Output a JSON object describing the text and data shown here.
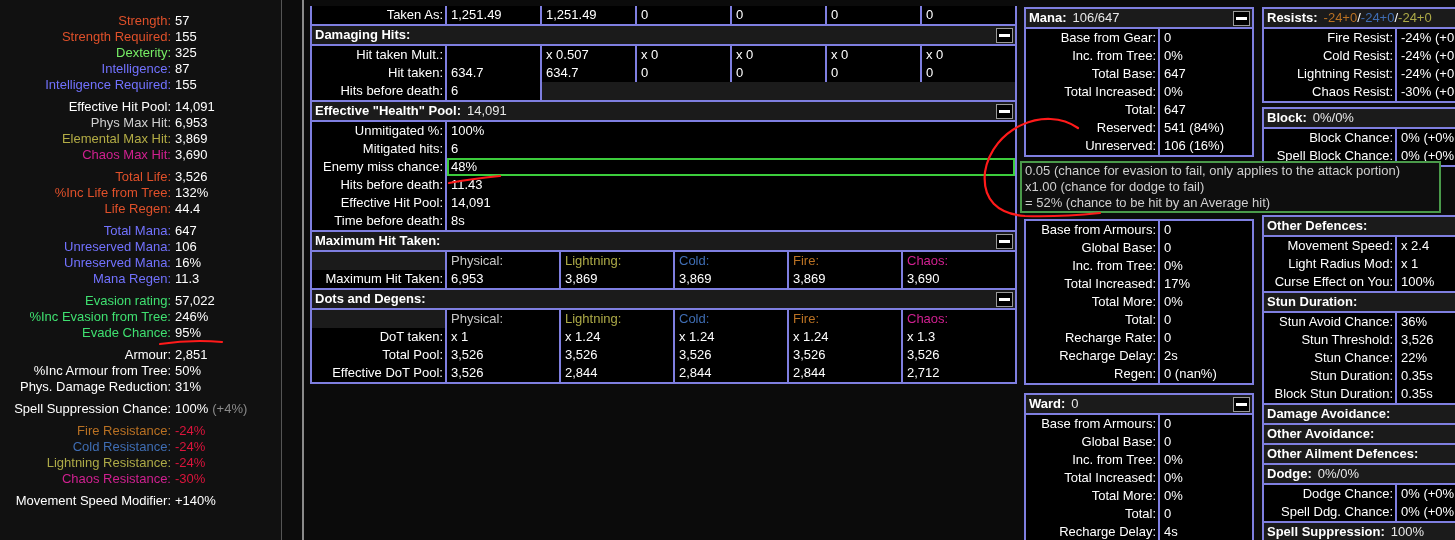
{
  "sidebar": {
    "groups": [
      {
        "rows": [
          {
            "label": "Strength:",
            "value": "57",
            "color": "#e0502a",
            "negative": false
          },
          {
            "label": "Strength Required:",
            "value": "155",
            "color": "#e0502a",
            "negative": false
          },
          {
            "label": "Dexterity:",
            "value": "325",
            "color": "#77ee66",
            "negative": false
          },
          {
            "label": "Intelligence:",
            "value": "87",
            "color": "#7272ff",
            "negative": false
          },
          {
            "label": "Intelligence Required:",
            "value": "155",
            "color": "#7272ff",
            "negative": false
          }
        ]
      },
      {
        "rows": [
          {
            "label": "Effective Hit Pool:",
            "value": "14,091",
            "color": "#ffffff",
            "negative": false
          },
          {
            "label": "Phys Max Hit:",
            "value": "6,953",
            "color": "#cfcfcf",
            "negative": false
          },
          {
            "label": "Elemental Max Hit:",
            "value": "3,869",
            "color": "#b3ac45",
            "negative": false
          },
          {
            "label": "Chaos Max Hit:",
            "value": "3,690",
            "color": "#d02090",
            "negative": false
          }
        ]
      },
      {
        "rows": [
          {
            "label": "Total Life:",
            "value": "3,526",
            "color": "#e0502a",
            "negative": false
          },
          {
            "label": "%Inc Life from Tree:",
            "value": "132%",
            "color": "#e0502a",
            "negative": false
          },
          {
            "label": "Life Regen:",
            "value": "44.4",
            "color": "#e0502a",
            "negative": false
          }
        ]
      },
      {
        "rows": [
          {
            "label": "Total Mana:",
            "value": "647",
            "color": "#7272ff",
            "negative": false
          },
          {
            "label": "Unreserved Mana:",
            "value": "106",
            "color": "#7272ff",
            "negative": false
          },
          {
            "label": "Unreserved Mana:",
            "value": "16%",
            "color": "#7272ff",
            "negative": false
          },
          {
            "label": "Mana Regen:",
            "value": "11.3",
            "color": "#7272ff",
            "negative": false
          }
        ]
      },
      {
        "rows": [
          {
            "label": "Evasion rating:",
            "value": "57,022",
            "color": "#3fe070",
            "negative": false
          },
          {
            "label": "%Inc Evasion from Tree:",
            "value": "246%",
            "color": "#3fe070",
            "negative": false
          },
          {
            "label": "Evade Chance:",
            "value": "95%",
            "color": "#3fe070",
            "negative": false
          }
        ]
      },
      {
        "rows": [
          {
            "label": "Armour:",
            "value": "2,851",
            "color": "#ffffff",
            "negative": false
          },
          {
            "label": "%Inc Armour from Tree:",
            "value": "50%",
            "color": "#ffffff",
            "negative": false
          },
          {
            "label": "Phys. Damage Reduction:",
            "value": "31%",
            "color": "#ffffff",
            "negative": false
          }
        ]
      },
      {
        "rows": [
          {
            "label": "Spell Suppression Chance:",
            "value": "100%",
            "color": "#ffffff",
            "negative": false,
            "note": "(+4%)"
          }
        ]
      },
      {
        "rows": [
          {
            "label": "Fire Resistance:",
            "value": "-24%",
            "color": "#b97123",
            "negative": true
          },
          {
            "label": "Cold Resistance:",
            "value": "-24%",
            "color": "#3f6db3",
            "negative": true
          },
          {
            "label": "Lightning Resistance:",
            "value": "-24%",
            "color": "#adaa47",
            "negative": true
          },
          {
            "label": "Chaos Resistance:",
            "value": "-30%",
            "color": "#d02090",
            "negative": true
          }
        ]
      },
      {
        "rows": [
          {
            "label": "Movement Speed Modifier:",
            "value": "+140%",
            "color": "#ffffff",
            "negative": false
          }
        ]
      }
    ]
  },
  "defence_sections": [
    {
      "kind": "grid",
      "rows": [
        {
          "label": "Taken As:",
          "cells": [
            "1,251.49",
            "1,251.49",
            "0",
            "0",
            "0",
            "0"
          ]
        }
      ]
    },
    {
      "kind": "grid",
      "title": "Damaging Hits:",
      "has_button": true,
      "rows": [
        {
          "label": "Hit taken Mult.:",
          "cells": [
            null,
            "x 0.507",
            "x 0",
            "x 0",
            "x 0",
            "x 0"
          ]
        },
        {
          "label": "Hit taken:",
          "cells": [
            "634.7",
            "634.7",
            "0",
            "0",
            "0",
            "0"
          ]
        },
        {
          "label": "Hits before death:",
          "cells": [
            "6"
          ]
        }
      ]
    },
    {
      "kind": "list",
      "title": "Effective \"Health\" Pool:",
      "value": "14,091",
      "has_button": true,
      "rows": [
        {
          "label": "Unmitigated %:",
          "value": "100%",
          "highlighted": false
        },
        {
          "label": "Mitigated hits:",
          "value": "6",
          "highlighted": false
        },
        {
          "label": "Enemy miss chance:",
          "value": "48%",
          "highlighted": true
        },
        {
          "label": "Hits before death:",
          "value": "11.43",
          "highlighted": false
        },
        {
          "label": "Effective Hit Pool:",
          "value": "14,091",
          "highlighted": false
        },
        {
          "label": "Time before death:",
          "value": "8s",
          "highlighted": false
        }
      ]
    },
    {
      "kind": "grid",
      "title": "Maximum Hit Taken:",
      "has_button": true,
      "columns": [
        {
          "label": "Physical:",
          "color": "#c8c8c8"
        },
        {
          "label": "Lightning:",
          "color": "#adaa47"
        },
        {
          "label": "Cold:",
          "color": "#3f6db3"
        },
        {
          "label": "Fire:",
          "color": "#b97123"
        },
        {
          "label": "Chaos:",
          "color": "#d02090"
        }
      ],
      "rows": [
        {
          "label": "Maximum Hit Taken:",
          "cells": [
            "6,953",
            "3,869",
            "3,869",
            "3,869",
            "3,690"
          ]
        }
      ]
    },
    {
      "kind": "grid",
      "title": "Dots and Degens:",
      "has_button": true,
      "columns": [
        {
          "label": "Physical:",
          "color": "#c8c8c8"
        },
        {
          "label": "Lightning:",
          "color": "#adaa47"
        },
        {
          "label": "Cold:",
          "color": "#3f6db3"
        },
        {
          "label": "Fire:",
          "color": "#b97123"
        },
        {
          "label": "Chaos:",
          "color": "#d02090"
        }
      ],
      "rows": [
        {
          "label": "DoT taken:",
          "cells": [
            "x 1",
            "x 1.24",
            "x 1.24",
            "x 1.24",
            "x 1.3"
          ]
        },
        {
          "label": "Total Pool:",
          "cells": [
            "3,526",
            "3,526",
            "3,526",
            "3,526",
            "3,526"
          ]
        },
        {
          "label": "Effective DoT Pool:",
          "cells": [
            "3,526",
            "2,844",
            "2,844",
            "2,844",
            "2,712"
          ]
        }
      ]
    }
  ],
  "side_columns": [
    {
      "groups": [
        {
          "sections": [
            {
              "kind": "list",
              "title": "Mana:",
              "value": "106/647",
              "has_button": true,
              "rows": [
                {
                  "label": "Base from Gear:",
                  "value": "0"
                },
                {
                  "label": "Inc. from Tree:",
                  "value": "0%"
                },
                {
                  "label": "Total Base:",
                  "value": "647"
                },
                {
                  "label": "Total Increased:",
                  "value": "0%"
                },
                {
                  "label": "Total:",
                  "value": "647"
                },
                {
                  "label": "Reserved:",
                  "value": "541 (84%)"
                },
                {
                  "label": "Unreserved:",
                  "value": "106 (16%)"
                }
              ]
            }
          ]
        },
        {
          "sections": [
            {
              "kind": "list",
              "rows": [
                {
                  "label": "Base from Armours:",
                  "value": "0"
                },
                {
                  "label": "Global Base:",
                  "value": "0"
                },
                {
                  "label": "Inc. from Tree:",
                  "value": "0%"
                },
                {
                  "label": "Total Increased:",
                  "value": "17%"
                },
                {
                  "label": "Total More:",
                  "value": "0%"
                },
                {
                  "label": "Total:",
                  "value": "0"
                },
                {
                  "label": "Recharge Rate:",
                  "value": "0"
                },
                {
                  "label": "Recharge Delay:",
                  "value": "2s"
                },
                {
                  "label": "Regen:",
                  "value": "0 (nan%)"
                }
              ]
            }
          ]
        },
        {
          "sections": [
            {
              "kind": "list",
              "title": "Ward:",
              "value": "0",
              "has_button": true,
              "rows": [
                {
                  "label": "Base from Armours:",
                  "value": "0"
                },
                {
                  "label": "Global Base:",
                  "value": "0"
                },
                {
                  "label": "Inc. from Tree:",
                  "value": "0%"
                },
                {
                  "label": "Total Increased:",
                  "value": "0%"
                },
                {
                  "label": "Total More:",
                  "value": "0%"
                },
                {
                  "label": "Total:",
                  "value": "0"
                },
                {
                  "label": "Recharge Delay:",
                  "value": "4s"
                }
              ]
            }
          ]
        }
      ]
    },
    {
      "groups": [
        {
          "sections": [
            {
              "kind": "list",
              "title": "Resists:",
              "has_button": false,
              "value_parts": [
                {
                  "text": "-24+0",
                  "color": "#b97123"
                },
                {
                  "text": "/"
                },
                {
                  "text": "-24+0",
                  "color": "#3f6db3"
                },
                {
                  "text": "/"
                },
                {
                  "text": "-24+0",
                  "color": "#adaa47"
                }
              ],
              "rows": [
                {
                  "label": "Fire Resist:",
                  "value": "-24% (+0"
                },
                {
                  "label": "Cold Resist:",
                  "value": "-24% (+0"
                },
                {
                  "label": "Lightning Resist:",
                  "value": "-24% (+0"
                },
                {
                  "label": "Chaos Resist:",
                  "value": "-30% (+0"
                }
              ]
            }
          ]
        },
        {
          "sections": [
            {
              "kind": "list",
              "title": "Block:",
              "value": "0%/0%",
              "has_button": false,
              "rows": [
                {
                  "label": "Block Chance:",
                  "value": "0% (+0%"
                },
                {
                  "label": "Spell Block Chance:",
                  "value": "0% (+0%"
                }
              ]
            }
          ]
        },
        {
          "sections": [
            {
              "kind": "list",
              "title": "Other Defences:",
              "has_button": false,
              "rows": [
                {
                  "label": "Movement Speed:",
                  "value": "x 2.4"
                },
                {
                  "label": "Light Radius Mod:",
                  "value": "x 1"
                },
                {
                  "label": "Curse Effect on You:",
                  "value": "100%"
                }
              ]
            },
            {
              "kind": "list",
              "title": "Stun Duration:",
              "has_button": false,
              "rows": [
                {
                  "label": "Stun Avoid Chance:",
                  "value": "36%"
                },
                {
                  "label": "Stun Threshold:",
                  "value": "3,526"
                },
                {
                  "label": "Stun Chance:",
                  "value": "22%"
                },
                {
                  "label": "Stun Duration:",
                  "value": "0.35s"
                },
                {
                  "label": "Block Stun Duration:",
                  "value": "0.35s"
                }
              ]
            },
            {
              "kind": "list",
              "title": "Damage Avoidance:",
              "has_button": false
            },
            {
              "kind": "list",
              "title": "Other Avoidance:",
              "has_button": false
            },
            {
              "kind": "list",
              "title": "Other Ailment Defences:",
              "has_button": false
            },
            {
              "kind": "list",
              "title": "Dodge:",
              "value": "0%/0%",
              "has_button": false,
              "rows": [
                {
                  "label": "Dodge Chance:",
                  "value": "0% (+0%"
                },
                {
                  "label": "Spell Ddg. Chance:",
                  "value": "0% (+0%"
                }
              ]
            },
            {
              "kind": "list",
              "title": "Spell Suppression:",
              "value": "100%",
              "has_button": false
            }
          ]
        }
      ]
    }
  ],
  "tooltip": {
    "lines": [
      "0.05 (chance for evasion to fail, only applies to the attack portion)",
      "x1.00 (chance for dodge to fail)",
      "= 52% (chance to be hit by an Average hit)"
    ]
  }
}
